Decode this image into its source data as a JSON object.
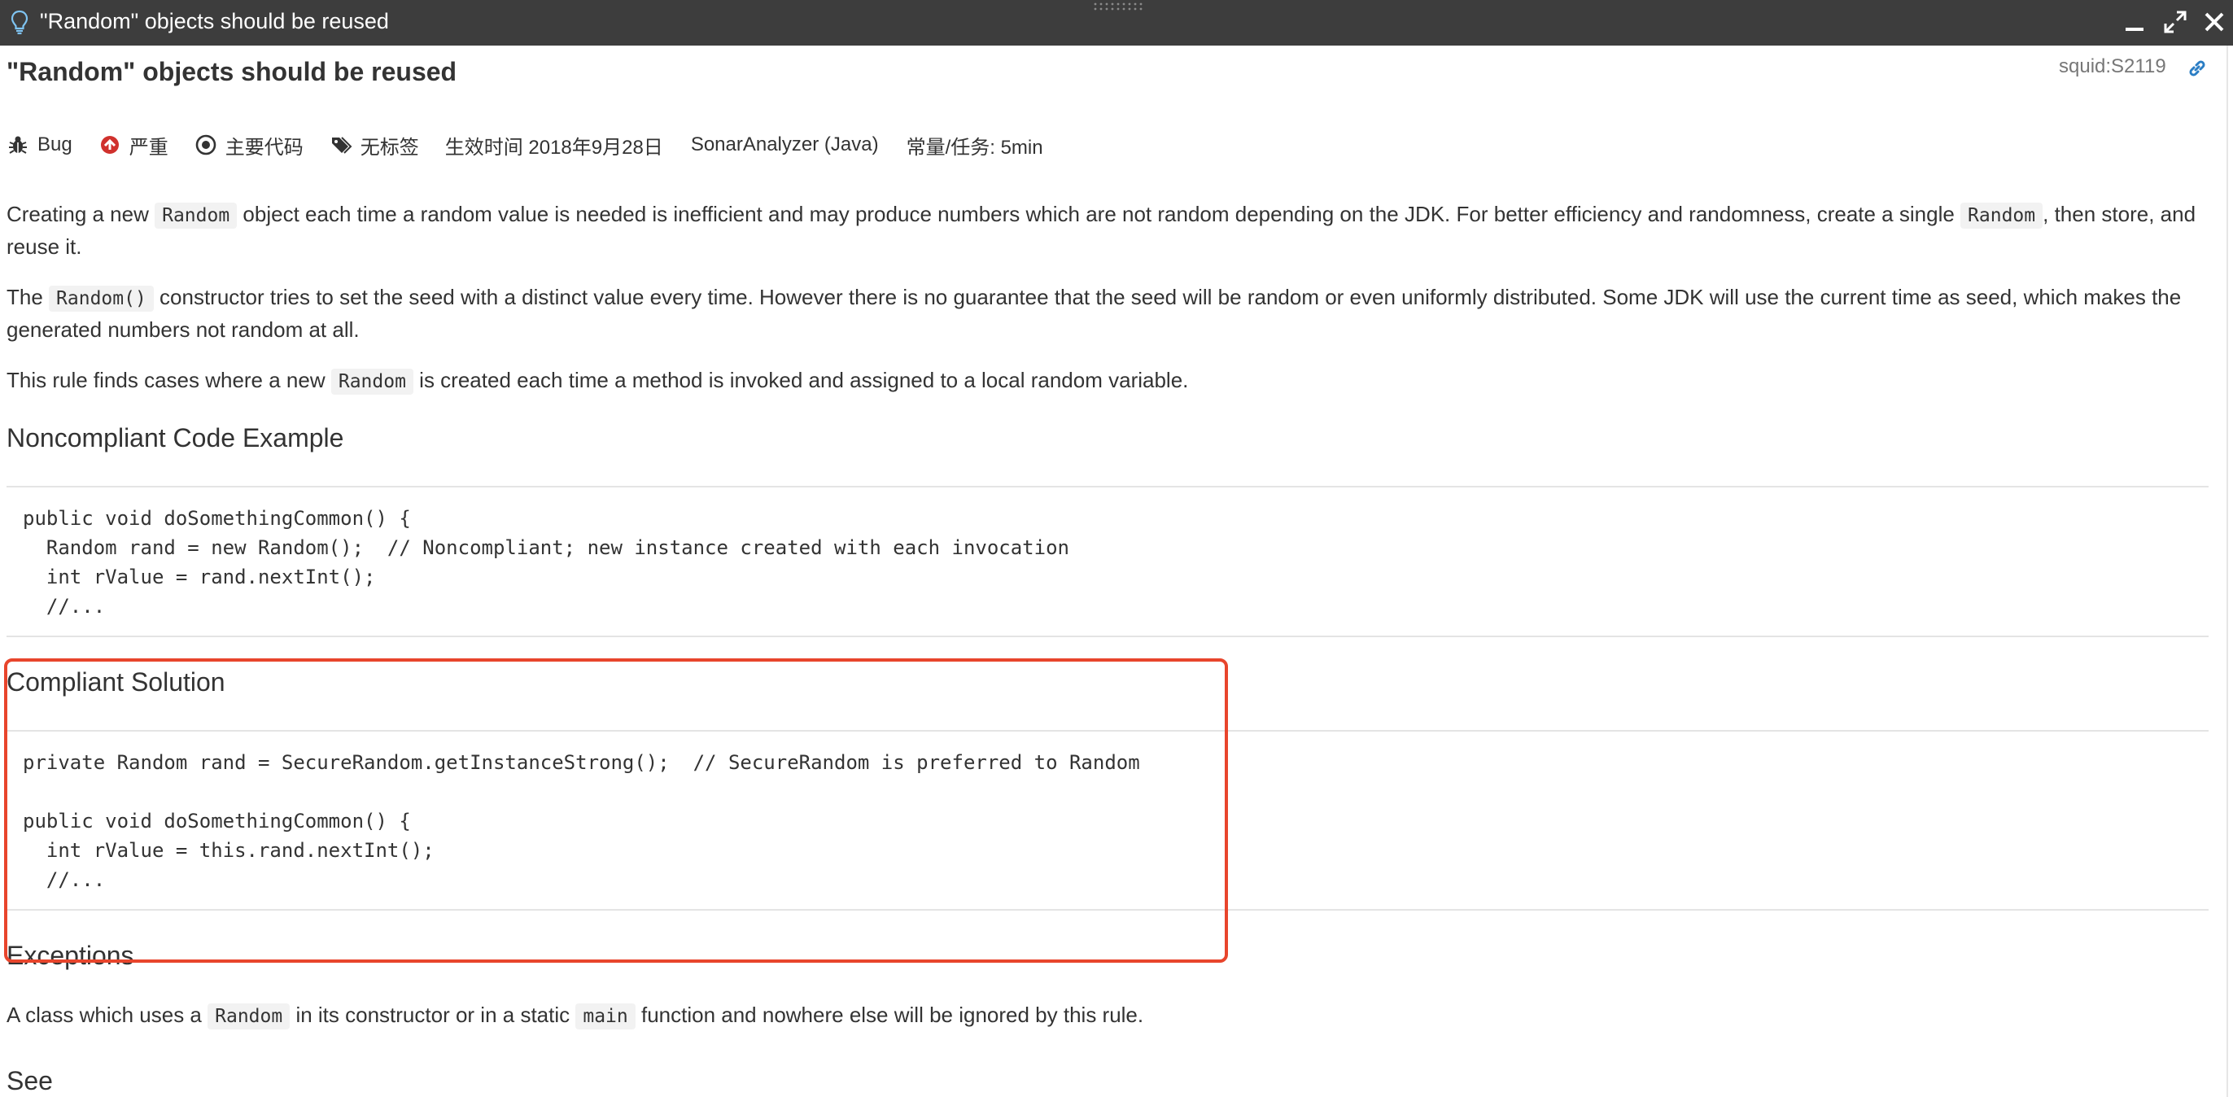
{
  "window": {
    "title": "\"Random\" objects should be reused"
  },
  "rule": {
    "title": "\"Random\" objects should be reused",
    "key": "squid:S2119"
  },
  "meta": {
    "type": "Bug",
    "severity": "严重",
    "scope": "主要代码",
    "tags": "无标签",
    "effective": "生效时间 2018年9月28日",
    "repository": "SonarAnalyzer (Java)",
    "debt": "常量/任务: 5min"
  },
  "description": {
    "p1_a": "Creating a new ",
    "p1_code1": "Random",
    "p1_b": " object each time a random value is needed is inefficient and may produce numbers which are not random depending on the JDK. For better efficiency and randomness, create a single ",
    "p1_code2": "Random",
    "p1_c": ", then store, and reuse it.",
    "p2_a": "The ",
    "p2_code": "Random()",
    "p2_b": " constructor tries to set the seed with a distinct value every time. However there is no guarantee that the seed will be random or even uniformly distributed. Some JDK will use the current time as seed, which makes the generated numbers not random at all.",
    "p3_a": "This rule finds cases where a new ",
    "p3_code": "Random",
    "p3_b": " is created each time a method is invoked and assigned to a local random variable."
  },
  "noncompliant": {
    "heading": "Noncompliant Code Example",
    "code": "public void doSomethingCommon() {\n  Random rand = new Random();  // Noncompliant; new instance created with each invocation\n  int rValue = rand.nextInt();\n  //..."
  },
  "compliant": {
    "heading": "Compliant Solution",
    "code": "private Random rand = SecureRandom.getInstanceStrong();  // SecureRandom is preferred to Random\n\npublic void doSomethingCommon() {\n  int rValue = this.rand.nextInt();\n  //..."
  },
  "exceptions": {
    "heading": "Exceptions",
    "text_a": "A class which uses a ",
    "code1": "Random",
    "text_b": " in its constructor or in a static ",
    "code2": "main",
    "text_c": " function and nowhere else will be ignored by this rule."
  },
  "see": {
    "heading": "See"
  },
  "colors": {
    "titlebar": "#3d3d3d",
    "highlight": "#e8452c",
    "link": "#2a7dc4",
    "severity": "#d0312d"
  }
}
